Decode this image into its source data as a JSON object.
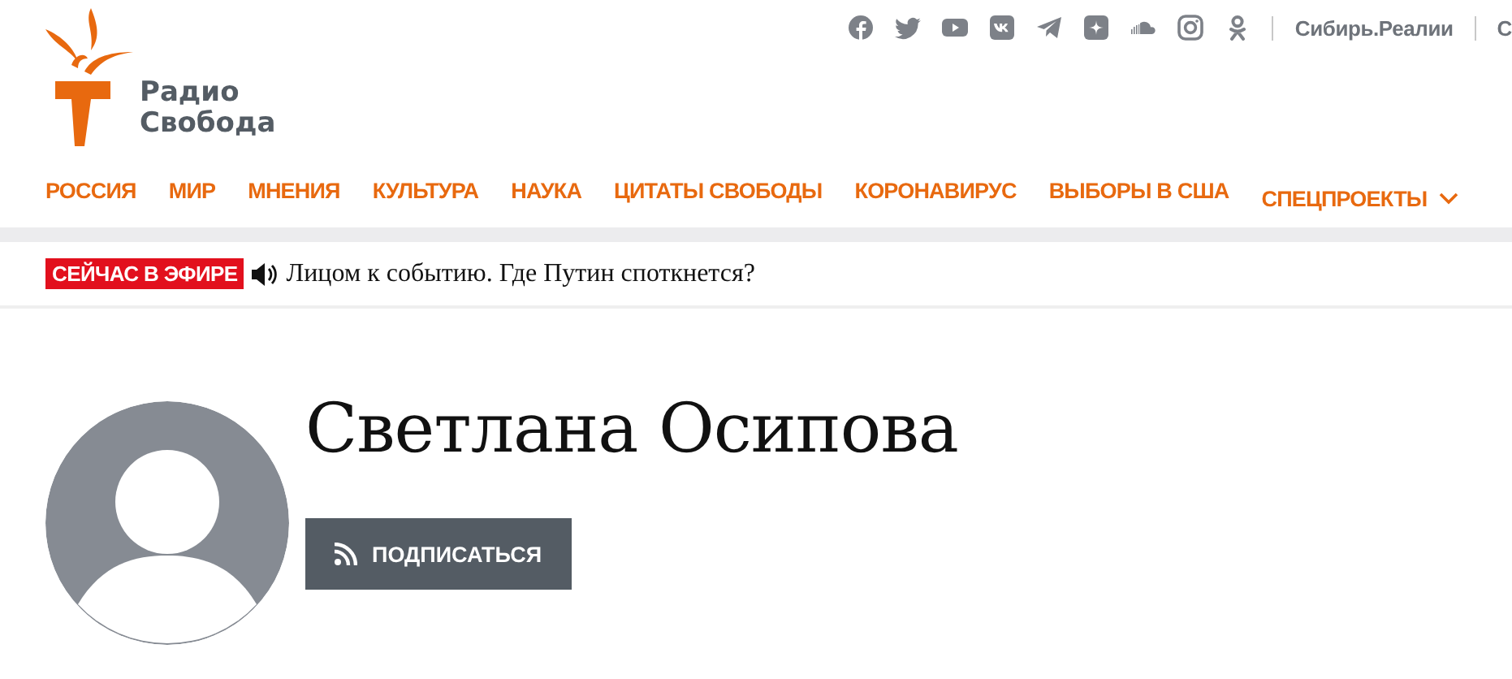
{
  "header": {
    "logo": {
      "line_1": "Радио",
      "line_2": "Свобода"
    },
    "social_icons": [
      {
        "kind": "facebook"
      },
      {
        "kind": "twitter"
      },
      {
        "kind": "youtube"
      },
      {
        "kind": "vk"
      },
      {
        "kind": "telegram"
      },
      {
        "kind": "zen"
      },
      {
        "kind": "soundcloud"
      },
      {
        "kind": "instagram"
      },
      {
        "kind": "odnoklassniki"
      }
    ],
    "site_links": [
      "Сибирь.Реалии",
      "С"
    ]
  },
  "nav": {
    "items": [
      {
        "label": "РОССИЯ"
      },
      {
        "label": "МИР"
      },
      {
        "label": "МНЕНИЯ"
      },
      {
        "label": "КУЛЬТУРА"
      },
      {
        "label": "НАУКА"
      },
      {
        "label": "ЦИТАТЫ СВОБОДЫ"
      },
      {
        "label": "КОРОНАВИРУС"
      },
      {
        "label": "ВЫБОРЫ В США"
      },
      {
        "label": "СПЕЦПРОЕКТЫ",
        "dropdown": true
      }
    ]
  },
  "live": {
    "badge": "СЕЙЧАС В ЭФИРЕ",
    "title": "Лицом к событию. Где Путин споткнется?"
  },
  "author": {
    "name": "Светлана Осипова",
    "subscribe_button": "ПОДПИСАТЬСЯ"
  }
}
